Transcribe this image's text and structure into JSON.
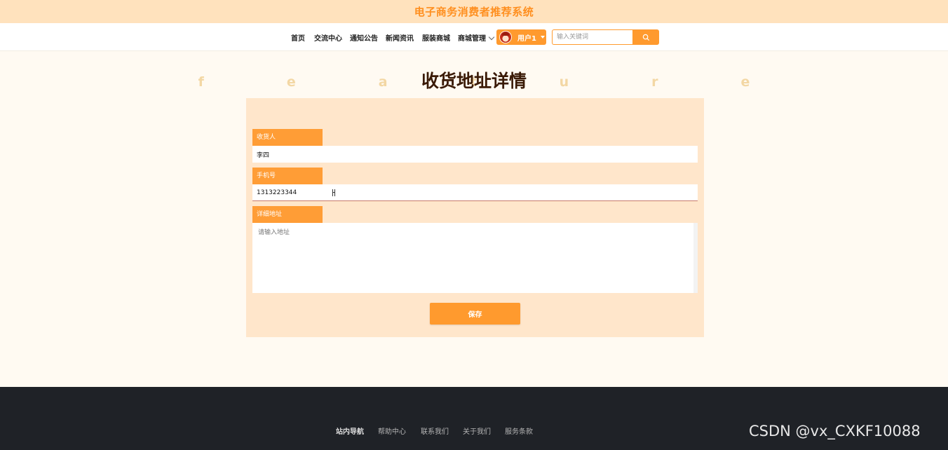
{
  "site": {
    "title": "电子商务消费者推荐系统"
  },
  "nav": {
    "items": [
      "首页",
      "交流中心",
      "通知公告",
      "新闻资讯",
      "服装商城",
      "商城管理"
    ],
    "user_label": "用户1",
    "search_placeholder": "输入关键词"
  },
  "page": {
    "heading": "收货地址详情",
    "heading_bg": "feature"
  },
  "form": {
    "fields": [
      {
        "label": "收货人",
        "value": "李四"
      },
      {
        "label": "手机号",
        "value": "1313223344"
      },
      {
        "label": "详细地址",
        "value": "",
        "placeholder": "请输入地址"
      }
    ],
    "save_label": "保存"
  },
  "footer": {
    "links": [
      "站内导航",
      "帮助中心",
      "联系我们",
      "关于我们",
      "服务条款"
    ],
    "watermark": "CSDN @vx_CXKF10088"
  },
  "colors": {
    "accent": "#ff9a2e",
    "banner": "#ffe2bd",
    "panel": "#ffe6cb",
    "footer": "#1f2227"
  }
}
